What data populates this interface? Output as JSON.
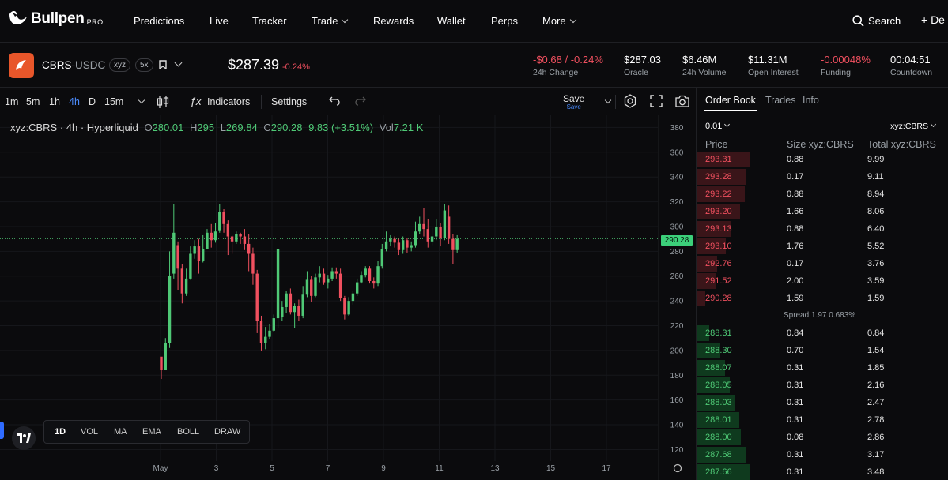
{
  "nav": {
    "logo_text": "Bullpen",
    "logo_badge": "PRO",
    "items": [
      "Predictions",
      "Live",
      "Tracker",
      "Trade",
      "Rewards",
      "Wallet",
      "Perps",
      "More"
    ],
    "search_label": "Search",
    "plus_label": "+ De"
  },
  "market": {
    "base": "CBRS",
    "quote": "-USDC",
    "tag": "xyz",
    "leverage": "5x",
    "price": "$287.39",
    "price_change": "-0.24%",
    "stats": [
      {
        "value": "-$0.68 / -0.24%",
        "label": "24h Change",
        "negative": true
      },
      {
        "value": "$287.03",
        "label": "Oracle"
      },
      {
        "value": "$6.46M",
        "label": "24h Volume"
      },
      {
        "value": "$11.31M",
        "label": "Open Interest"
      },
      {
        "value": "-0.00048%",
        "label": "Funding",
        "negative": true
      },
      {
        "value": "00:04:51",
        "label": "Countdown"
      }
    ]
  },
  "toolbar": {
    "timeframes": [
      "1m",
      "5m",
      "1h",
      "4h",
      "D",
      "15m"
    ],
    "active_timeframe": "4h",
    "indicators_label": "Indicators",
    "settings_label": "Settings",
    "save_label": "Save",
    "save_sub": "Save"
  },
  "legend": {
    "symbol": "xyz:CBRS · 4h · Hyperliquid",
    "o_label": "O",
    "o": "280.01",
    "h_label": "H",
    "h": "295",
    "l_label": "L",
    "l": "269.84",
    "c_label": "C",
    "c": "290.28",
    "change": "9.83 (+3.51%)",
    "vol_label": "Vol",
    "vol": "7.21 K"
  },
  "chart_data": {
    "type": "candlestick",
    "y_ticks": [
      120,
      140,
      160,
      180,
      200,
      220,
      240,
      260,
      280,
      300,
      320,
      340,
      360,
      380
    ],
    "ylim": [
      112,
      386
    ],
    "x_ticks": [
      "May",
      "3",
      "5",
      "7",
      "9",
      "11",
      "13",
      "15",
      "17"
    ],
    "last_price": "290.28",
    "candles": [
      [
        195,
        184,
        177,
        184
      ],
      [
        184,
        206,
        184,
        210
      ],
      [
        206,
        260,
        202,
        280
      ],
      [
        262,
        295,
        258,
        318
      ],
      [
        285,
        266,
        249,
        288
      ],
      [
        266,
        246,
        238,
        270
      ],
      [
        246,
        258,
        244,
        266
      ],
      [
        258,
        278,
        257,
        284
      ],
      [
        278,
        284,
        274,
        289
      ],
      [
        284,
        272,
        262,
        290
      ],
      [
        272,
        282,
        271,
        293
      ],
      [
        282,
        295,
        282,
        298
      ],
      [
        295,
        289,
        283,
        302
      ],
      [
        289,
        296,
        287,
        303
      ],
      [
        297,
        312,
        295,
        318
      ],
      [
        312,
        302,
        295,
        314
      ],
      [
        302,
        292,
        277,
        305
      ],
      [
        292,
        288,
        278,
        293
      ],
      [
        288,
        294,
        286,
        296
      ],
      [
        294,
        292,
        286,
        295
      ],
      [
        292,
        286,
        281,
        298
      ],
      [
        286,
        278,
        264,
        294
      ],
      [
        278,
        262,
        253,
        283
      ],
      [
        262,
        224,
        214,
        265
      ],
      [
        224,
        206,
        200,
        228
      ],
      [
        206,
        211,
        201,
        219
      ],
      [
        211,
        216,
        209,
        221
      ],
      [
        216,
        226,
        215,
        229
      ],
      [
        226,
        282,
        218,
        230
      ],
      [
        227,
        235,
        224,
        240
      ],
      [
        235,
        246,
        230,
        248
      ],
      [
        246,
        231,
        229,
        250
      ],
      [
        231,
        236,
        218,
        238
      ],
      [
        236,
        228,
        224,
        241
      ],
      [
        228,
        245,
        226,
        252
      ],
      [
        245,
        257,
        243,
        264
      ],
      [
        257,
        244,
        239,
        260
      ],
      [
        244,
        259,
        243,
        262
      ],
      [
        259,
        262,
        255,
        268
      ],
      [
        262,
        255,
        253,
        266
      ],
      [
        255,
        258,
        250,
        261
      ],
      [
        258,
        264,
        256,
        267
      ],
      [
        264,
        262,
        258,
        267
      ],
      [
        262,
        242,
        240,
        266
      ],
      [
        242,
        229,
        225,
        244
      ],
      [
        229,
        240,
        228,
        243
      ],
      [
        240,
        246,
        237,
        248
      ],
      [
        246,
        255,
        244,
        258
      ],
      [
        255,
        261,
        254,
        264
      ],
      [
        261,
        266,
        259,
        268
      ],
      [
        266,
        256,
        254,
        268
      ],
      [
        256,
        254,
        250,
        259
      ],
      [
        254,
        268,
        252,
        272
      ],
      [
        268,
        282,
        266,
        286
      ],
      [
        282,
        288,
        280,
        296
      ],
      [
        288,
        290,
        284,
        293
      ],
      [
        290,
        287,
        283,
        292
      ],
      [
        287,
        281,
        277,
        290
      ],
      [
        281,
        289,
        278,
        292
      ],
      [
        289,
        283,
        279,
        291
      ],
      [
        283,
        285,
        280,
        288
      ],
      [
        285,
        296,
        283,
        304
      ],
      [
        296,
        302,
        294,
        308
      ],
      [
        302,
        298,
        292,
        315
      ],
      [
        298,
        288,
        283,
        306
      ],
      [
        288,
        292,
        285,
        299
      ],
      [
        292,
        300,
        289,
        306
      ],
      [
        300,
        291,
        284,
        303
      ],
      [
        291,
        313,
        289,
        318
      ],
      [
        308,
        290,
        286,
        317
      ],
      [
        290,
        281,
        270,
        294
      ],
      [
        281,
        290,
        279,
        293
      ]
    ]
  },
  "bottom_tools": [
    "1D",
    "VOL",
    "MA",
    "EMA",
    "BOLL",
    "DRAW"
  ],
  "orderbook": {
    "tabs": [
      "Order Book",
      "Trades",
      "Info"
    ],
    "tick": "0.01",
    "unit": "xyz:CBRS",
    "headers": [
      "Price",
      "Size xyz:CBRS",
      "Total xyz:CBRS"
    ],
    "asks": [
      {
        "price": "293.31",
        "size": "0.88",
        "total": "9.99",
        "depth": 1.0
      },
      {
        "price": "293.28",
        "size": "0.17",
        "total": "9.11",
        "depth": 0.91
      },
      {
        "price": "293.22",
        "size": "0.88",
        "total": "8.94",
        "depth": 0.9
      },
      {
        "price": "293.20",
        "size": "1.66",
        "total": "8.06",
        "depth": 0.81
      },
      {
        "price": "293.13",
        "size": "0.88",
        "total": "6.40",
        "depth": 0.64
      },
      {
        "price": "293.10",
        "size": "1.76",
        "total": "5.52",
        "depth": 0.55
      },
      {
        "price": "292.76",
        "size": "0.17",
        "total": "3.76",
        "depth": 0.38
      },
      {
        "price": "291.52",
        "size": "2.00",
        "total": "3.59",
        "depth": 0.36
      },
      {
        "price": "290.28",
        "size": "1.59",
        "total": "1.59",
        "depth": 0.16
      }
    ],
    "spread": "Spread 1.97 0.683%",
    "bids": [
      {
        "price": "288.31",
        "size": "0.84",
        "total": "0.84",
        "depth": 0.24
      },
      {
        "price": "288.30",
        "size": "0.70",
        "total": "1.54",
        "depth": 0.44
      },
      {
        "price": "288.07",
        "size": "0.31",
        "total": "1.85",
        "depth": 0.53
      },
      {
        "price": "288.05",
        "size": "0.31",
        "total": "2.16",
        "depth": 0.62
      },
      {
        "price": "288.03",
        "size": "0.31",
        "total": "2.47",
        "depth": 0.71
      },
      {
        "price": "288.01",
        "size": "0.31",
        "total": "2.78",
        "depth": 0.8
      },
      {
        "price": "288.00",
        "size": "0.08",
        "total": "2.86",
        "depth": 0.82
      },
      {
        "price": "287.68",
        "size": "0.31",
        "total": "3.17",
        "depth": 0.91
      },
      {
        "price": "287.66",
        "size": "0.31",
        "total": "3.48",
        "depth": 1.0
      }
    ]
  },
  "colors": {
    "up": "#4fc976",
    "down": "#f0505f",
    "accent": "#4c8dff",
    "brand": "#e8562a"
  }
}
